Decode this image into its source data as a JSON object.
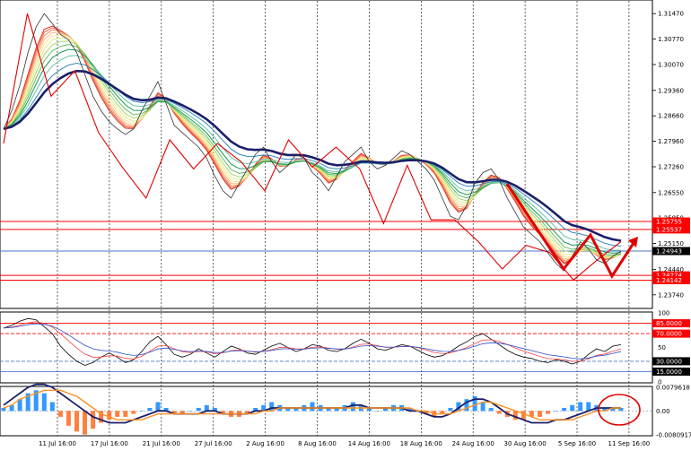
{
  "chart_data": {
    "type": "line",
    "price_axis": {
      "ticks": [
        "1.31470",
        "1.30770",
        "1.30070",
        "1.29360",
        "1.28660",
        "1.27960",
        "1.27260",
        "1.26550",
        "1.25850",
        "1.25150",
        "1.24440",
        "1.23740"
      ],
      "ylim": [
        1.2339,
        1.3182
      ]
    },
    "x_labels": [
      "11 Jul 16:00",
      "17 Jul 16:00",
      "21 Jul 16:00",
      "27 Jul 16:00",
      "2 Aug 16:00",
      "8 Aug 16:00",
      "14 Aug 16:00",
      "18 Aug 16:00",
      "24 Aug 16:00",
      "30 Aug 16:00",
      "5 Sep 16:00",
      "11 Sep 16:00"
    ],
    "levels": [
      {
        "label": "1.25755",
        "value": 1.25755,
        "color": "#ff0000"
      },
      {
        "label": "1.25537",
        "value": 1.25537,
        "color": "#ff0000"
      },
      {
        "label": "1.24943",
        "value": 1.24943,
        "color": "#4a74c9"
      },
      {
        "label": "1.24274",
        "value": 1.24274,
        "color": "#ff0000"
      },
      {
        "label": "1.24142",
        "value": 1.24142,
        "color": "#ff0000"
      }
    ],
    "price_close": [
      1.283,
      1.288,
      1.295,
      1.304,
      1.311,
      1.3147,
      1.312,
      1.309,
      1.3075,
      1.304,
      1.298,
      1.292,
      1.288,
      1.285,
      1.283,
      1.2815,
      1.283,
      1.288,
      1.292,
      1.296,
      1.29,
      1.284,
      1.282,
      1.28,
      1.278,
      1.275,
      1.27,
      1.266,
      1.264,
      1.268,
      1.272,
      1.276,
      1.278,
      1.274,
      1.271,
      1.273,
      1.276,
      1.275,
      1.271,
      1.269,
      1.266,
      1.27,
      1.274,
      1.276,
      1.278,
      1.274,
      1.272,
      1.273,
      1.275,
      1.277,
      1.276,
      1.274,
      1.272,
      1.269,
      1.264,
      1.259,
      1.258,
      1.262,
      1.268,
      1.271,
      1.272,
      1.269,
      1.264,
      1.26,
      1.256,
      1.254,
      1.252,
      1.249,
      1.246,
      1.244,
      1.248,
      1.252,
      1.25,
      1.247,
      1.246,
      1.248,
      1.2494
    ],
    "zigzag": [
      1.279,
      1.3147,
      1.292,
      1.299,
      1.282,
      1.2725,
      1.264,
      1.28,
      1.272,
      1.279,
      1.274,
      1.266,
      1.28,
      1.2725,
      1.278,
      1.272,
      1.257,
      1.273,
      1.258,
      1.258,
      1.252,
      1.2445,
      1.251,
      1.249,
      1.2415,
      1.247,
      1.252
    ],
    "rsi": {
      "ylim": [
        0,
        100
      ],
      "ticks": [
        "100",
        "85.0000",
        "70.0000",
        "50",
        "30.0000",
        "15.0000",
        "0"
      ],
      "levels": [
        {
          "label": "85.0000",
          "value": 85,
          "color": "#ff0000"
        },
        {
          "label": "70.0000",
          "value": 70,
          "color": "#ff0000"
        },
        {
          "label": "30.0000",
          "value": 30,
          "color": "#4a74c9"
        },
        {
          "label": "15.0000",
          "value": 15,
          "color": "#4a74c9"
        }
      ],
      "values": [
        78,
        82,
        88,
        92,
        90,
        80,
        70,
        52,
        40,
        30,
        24,
        28,
        36,
        42,
        36,
        28,
        32,
        44,
        58,
        66,
        54,
        40,
        36,
        40,
        48,
        42,
        36,
        44,
        52,
        48,
        42,
        40,
        46,
        52,
        56,
        50,
        44,
        48,
        54,
        52,
        46,
        44,
        48,
        56,
        62,
        56,
        48,
        46,
        50,
        54,
        52,
        46,
        40,
        36,
        38,
        44,
        52,
        58,
        66,
        70,
        62,
        54,
        46,
        40,
        36,
        34,
        30,
        28,
        32,
        30,
        26,
        30,
        40,
        48,
        44,
        52,
        54
      ]
    },
    "macd": {
      "ticks": [
        "0.0079618",
        "0.00",
        "-0.0080917"
      ],
      "ylim": [
        -0.0081,
        0.008
      ],
      "histogram": [
        0.001,
        0.002,
        0.004,
        0.006,
        0.007,
        0.006,
        0.003,
        -0.002,
        -0.005,
        -0.007,
        -0.008,
        -0.006,
        -0.004,
        -0.003,
        -0.002,
        -0.002,
        -0.001,
        0.0,
        0.001,
        0.003,
        0.001,
        -0.001,
        -0.001,
        0.0,
        0.001,
        0.002,
        0.001,
        -0.001,
        -0.002,
        -0.002,
        -0.001,
        0.001,
        0.002,
        0.003,
        0.002,
        0.001,
        0.001,
        0.002,
        0.003,
        0.002,
        0.001,
        0.001,
        0.002,
        0.003,
        0.002,
        0.001,
        0.0,
        0.001,
        0.002,
        0.002,
        0.001,
        0.0,
        -0.001,
        -0.002,
        -0.001,
        0.001,
        0.003,
        0.004,
        0.005,
        0.003,
        0.001,
        -0.001,
        -0.002,
        -0.003,
        -0.003,
        -0.002,
        -0.002,
        -0.001,
        0.0,
        0.001,
        0.002,
        0.003,
        0.003,
        0.002,
        0.001,
        0.001,
        0.001
      ],
      "main": [
        0.002,
        0.004,
        0.006,
        0.008,
        0.009,
        0.009,
        0.008,
        0.006,
        0.004,
        0.002,
        0.0,
        -0.002,
        -0.003,
        -0.004,
        -0.004,
        -0.004,
        -0.003,
        -0.002,
        -0.001,
        0.0,
        0.0,
        -0.001,
        -0.001,
        -0.001,
        -0.001,
        0.0,
        0.0,
        -0.001,
        -0.001,
        -0.001,
        -0.001,
        0.0,
        0.0,
        0.001,
        0.001,
        0.001,
        0.001,
        0.001,
        0.001,
        0.001,
        0.001,
        0.001,
        0.001,
        0.002,
        0.002,
        0.001,
        0.001,
        0.001,
        0.001,
        0.001,
        0.0,
        0.0,
        -0.001,
        -0.002,
        -0.002,
        -0.001,
        0.001,
        0.003,
        0.004,
        0.004,
        0.003,
        0.001,
        -0.001,
        -0.002,
        -0.003,
        -0.004,
        -0.004,
        -0.004,
        -0.003,
        -0.003,
        -0.002,
        -0.001,
        0.0,
        0.001,
        0.001,
        0.001,
        0.001
      ],
      "signal": [
        0.001,
        0.002,
        0.004,
        0.005,
        0.006,
        0.007,
        0.007,
        0.007,
        0.006,
        0.005,
        0.003,
        0.001,
        -0.001,
        -0.002,
        -0.003,
        -0.003,
        -0.003,
        -0.003,
        -0.002,
        -0.001,
        -0.001,
        -0.001,
        -0.001,
        -0.001,
        -0.001,
        -0.001,
        -0.001,
        -0.001,
        -0.001,
        -0.001,
        -0.001,
        -0.001,
        0.0,
        0.0,
        0.001,
        0.001,
        0.001,
        0.001,
        0.001,
        0.001,
        0.001,
        0.001,
        0.001,
        0.001,
        0.001,
        0.001,
        0.001,
        0.001,
        0.001,
        0.001,
        0.001,
        0.0,
        0.0,
        -0.001,
        -0.001,
        -0.001,
        0.0,
        0.001,
        0.002,
        0.003,
        0.003,
        0.002,
        0.001,
        0.0,
        -0.001,
        -0.002,
        -0.003,
        -0.003,
        -0.003,
        -0.003,
        -0.003,
        -0.002,
        -0.001,
        0.0,
        0.0,
        0.001,
        0.001
      ]
    }
  }
}
